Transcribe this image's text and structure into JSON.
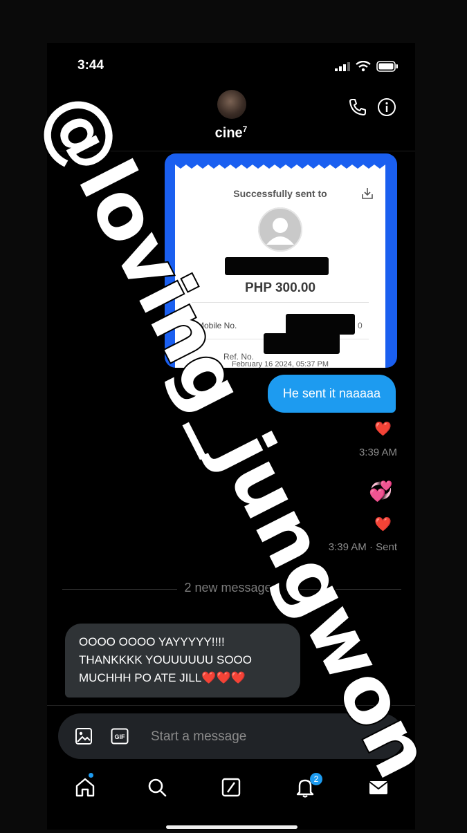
{
  "status_bar": {
    "time": "3:44"
  },
  "header": {
    "contact_name": "cine",
    "name_superscript": "7"
  },
  "receipt": {
    "title": "Successfully sent to",
    "amount": "PHP 300.00",
    "mobile_label": "Mobile No.",
    "mobile_suffix": "0",
    "ref_label": "Ref. No.",
    "date": "February 16 2024, 05:37 PM"
  },
  "messages": {
    "outgoing_text": "He sent it naaaaa",
    "reaction_heart": "❤️",
    "timestamp_1": "3:39 AM",
    "sparkle_heart": "💞",
    "timestamp_2": "3:39 AM · Sent",
    "new_messages_divider": "2 new messages",
    "incoming_text": "OOOO OOOO YAYYYYY!!!! THANKKKK YOUUUUUU SOOO MUCHHH PO ATE JILL❤️❤️❤️"
  },
  "composer": {
    "placeholder": "Start a message"
  },
  "tabbar": {
    "notifications_badge": "2"
  },
  "watermark": {
    "text": "@loving_jungwon"
  },
  "colors": {
    "accent": "#1d9bf0",
    "receipt_border": "#1a5ff0",
    "bubble_in": "#2f3336"
  }
}
